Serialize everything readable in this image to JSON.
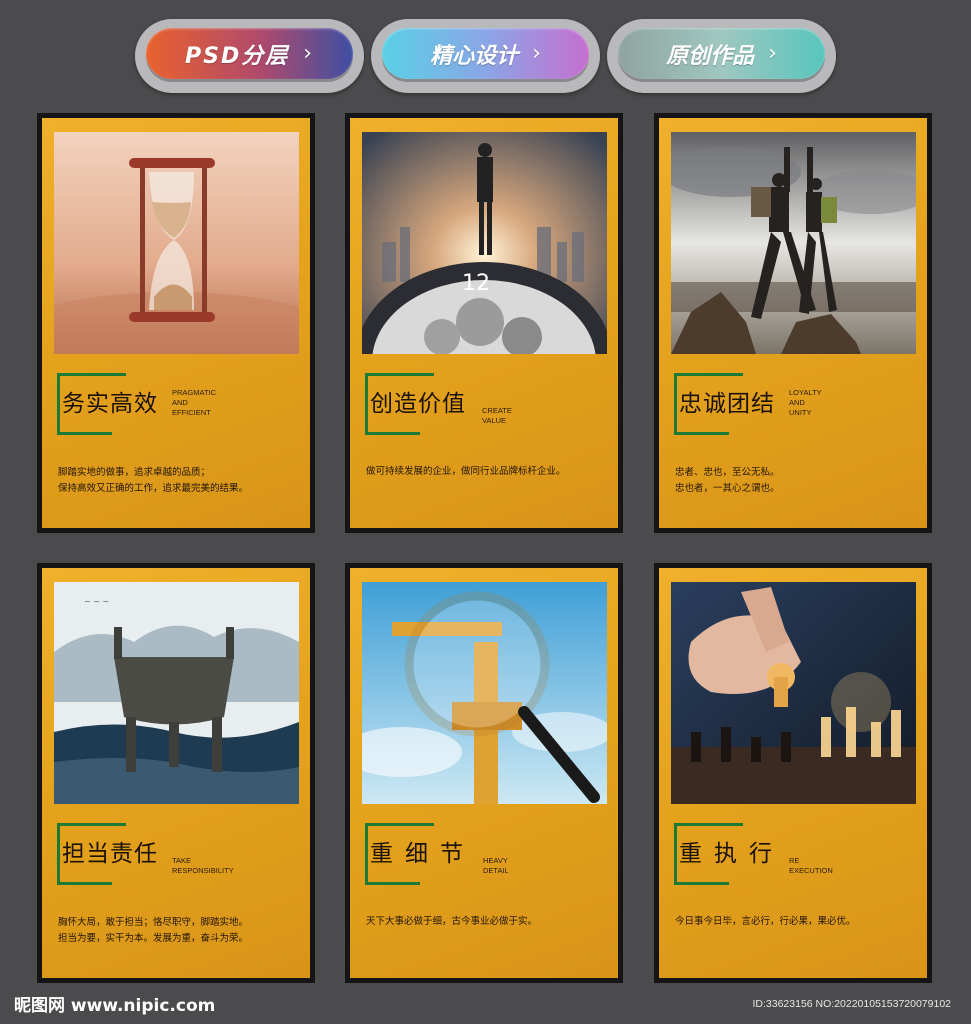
{
  "tags": [
    {
      "label": "PSD分层",
      "chevron": "›"
    },
    {
      "label": "精心设计",
      "chevron": "›"
    },
    {
      "label": "原创作品",
      "chevron": "›"
    }
  ],
  "cards": [
    {
      "title": "务实高效",
      "en": [
        "PRAGMATIC",
        "AND",
        "EFFICIENT"
      ],
      "desc": [
        "脚踏实地的做事，追求卓越的品质；",
        "保持高效又正确的工作，追求最完美的结果。"
      ]
    },
    {
      "title": "创造价值",
      "en": [
        "CREATE",
        "VALUE"
      ],
      "desc": [
        "做可持续发展的企业，做同行业品牌标杆企业。"
      ]
    },
    {
      "title": "忠诚团结",
      "en": [
        "LOYALTY",
        "AND",
        "UNITY"
      ],
      "desc": [
        "忠者、忠也，至公无私。",
        "忠也者，一其心之谓也。"
      ]
    },
    {
      "title": "担当责任",
      "en": [
        "TAKE",
        "RESPONSIBILITY"
      ],
      "desc": [
        "胸怀大局，敢于担当；恪尽职守，脚踏实地。",
        "担当为要，实干为本。发展为重，奋斗为荣。"
      ]
    },
    {
      "title": "重细节",
      "en": [
        "HEAVY",
        "DETAIL"
      ],
      "desc": [
        "天下大事必做于细，古今事业必做于实。"
      ]
    },
    {
      "title": "重执行",
      "en": [
        "RE",
        "EXECUTION"
      ],
      "desc": [
        "今日事今日毕，言必行，行必果，果必优。"
      ]
    }
  ],
  "footer": {
    "logo": "昵图网 www.nipic.com",
    "id": "ID:33623156 NO:20220105153720079102"
  }
}
